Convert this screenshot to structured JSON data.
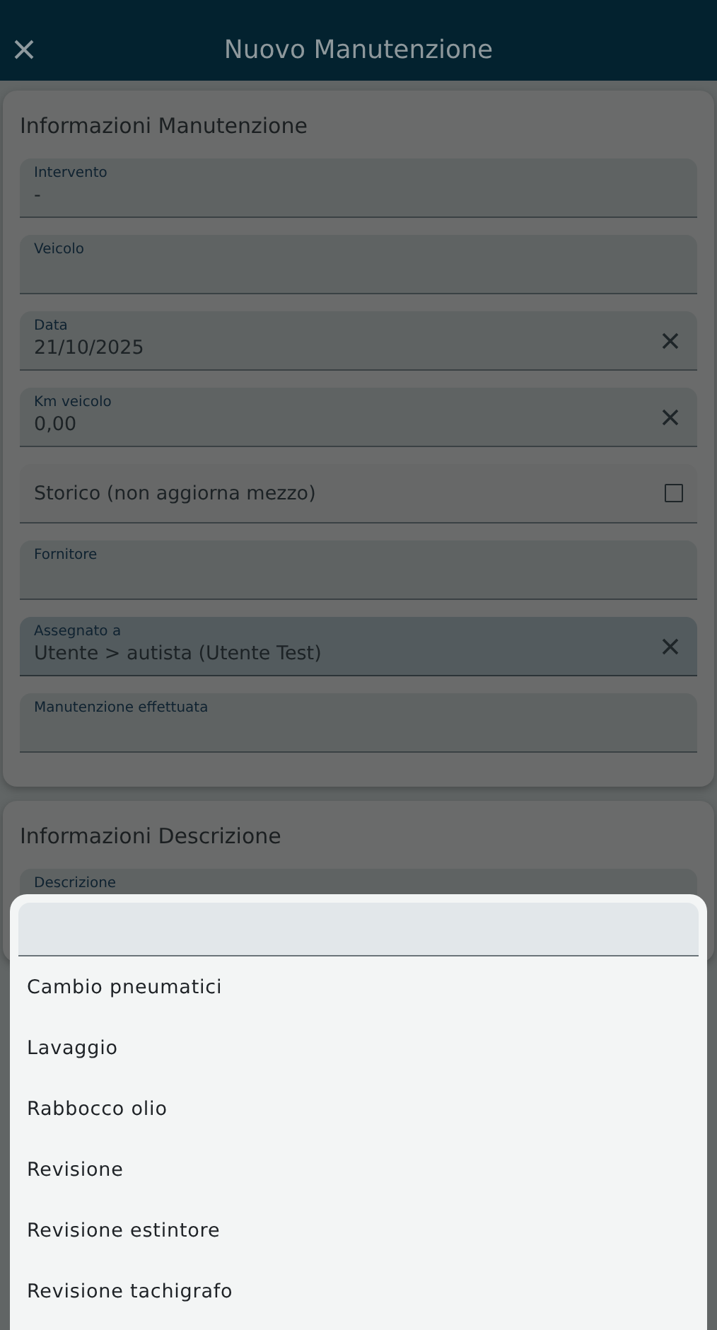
{
  "header": {
    "title": "Nuovo Manutenzione"
  },
  "sections": [
    {
      "title": "Informazioni Manutenzione",
      "fields": [
        {
          "kind": "text",
          "label": "Intervento",
          "value": "-",
          "clearable": false,
          "focused": false
        },
        {
          "kind": "text",
          "label": "Veicolo",
          "clearable": false,
          "focused": false
        },
        {
          "kind": "text",
          "label": "Data",
          "value": "21/10/2025",
          "clearable": true,
          "focused": false
        },
        {
          "kind": "text",
          "label": "Km veicolo",
          "value": "0,00",
          "clearable": true,
          "focused": false
        },
        {
          "kind": "checkbox",
          "label": "Storico (non aggiorna mezzo)",
          "checked": false
        },
        {
          "kind": "text",
          "label": "Fornitore",
          "clearable": false,
          "focused": false
        },
        {
          "kind": "text",
          "label": "Assegnato a",
          "value": "Utente > autista (Utente Test)",
          "clearable": true,
          "focused": true
        },
        {
          "kind": "text",
          "label": "Manutenzione effettuata",
          "clearable": false,
          "focused": false
        }
      ]
    },
    {
      "title": "Informazioni Descrizione",
      "fields": [
        {
          "kind": "text",
          "label": "Descrizione",
          "clearable": false,
          "focused": false
        }
      ]
    }
  ],
  "picker": {
    "options": [
      {
        "label": "Cambio pneumatici"
      },
      {
        "label": "Lavaggio"
      },
      {
        "label": "Rabbocco olio"
      },
      {
        "label": "Revisione"
      },
      {
        "label": "Revisione estintore"
      },
      {
        "label": "Revisione tachigrafo"
      }
    ]
  }
}
